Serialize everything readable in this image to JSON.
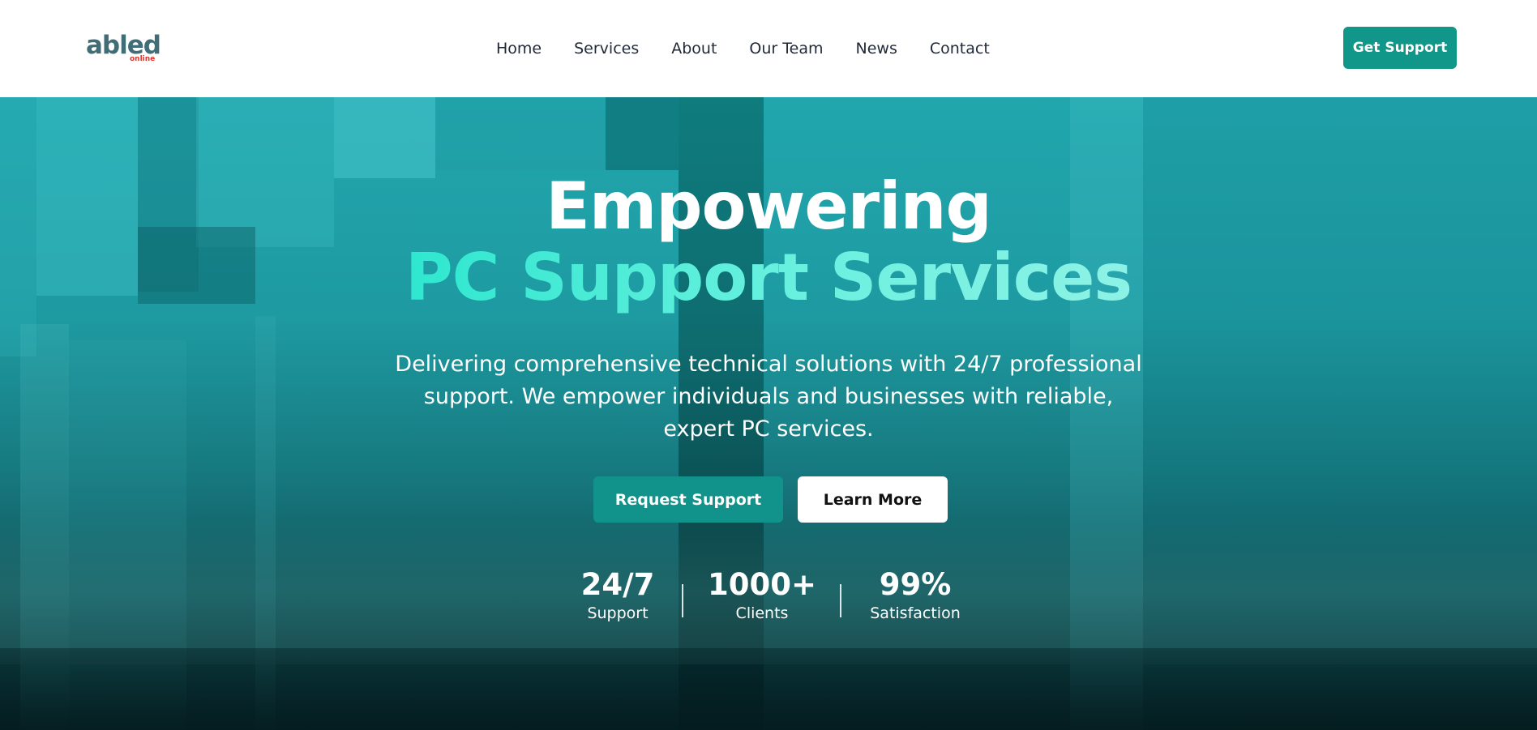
{
  "brand": {
    "logo_text": "abled",
    "logo_subtext": "online",
    "logo_accent_color": "#e0352b",
    "logo_color": "#3f6e77"
  },
  "nav": {
    "items": [
      {
        "label": "Home"
      },
      {
        "label": "Services"
      },
      {
        "label": "About"
      },
      {
        "label": "Our Team"
      },
      {
        "label": "News"
      },
      {
        "label": "Contact"
      }
    ],
    "cta_label": "Get Support"
  },
  "hero": {
    "title_line1": "Empowering",
    "title_line2": "PC Support Services",
    "subtitle": "Delivering comprehensive technical solutions with 24/7 professional support. We empower individuals and businesses with reliable, expert PC services.",
    "primary_button": "Request Support",
    "secondary_button": "Learn More",
    "stats": [
      {
        "value": "24/7",
        "label": "Support"
      },
      {
        "value": "1000+",
        "label": "Clients"
      },
      {
        "value": "99%",
        "label": "Satisfaction"
      }
    ]
  },
  "colors": {
    "accent": "#11968a",
    "headline_gradient_start": "#2ee7cf",
    "headline_gradient_end": "#8ef2e6"
  }
}
